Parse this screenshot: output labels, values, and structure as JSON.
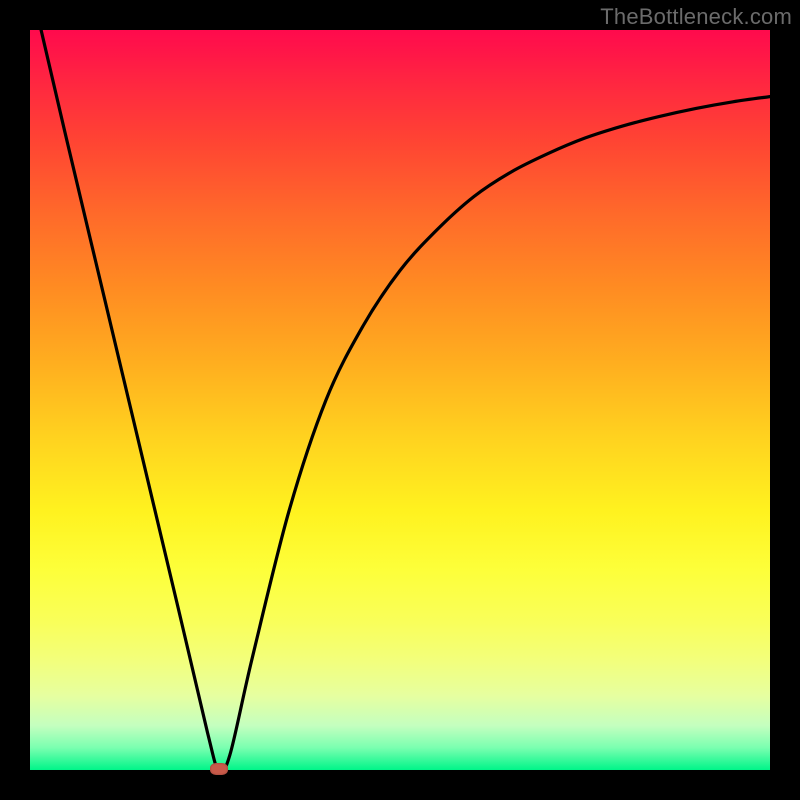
{
  "watermark": "TheBottleneck.com",
  "chart_data": {
    "type": "line",
    "title": "",
    "xlabel": "",
    "ylabel": "",
    "xlim": [
      0,
      100
    ],
    "ylim": [
      0,
      100
    ],
    "grid": false,
    "legend": false,
    "series": [
      {
        "name": "bottleneck-curve",
        "x": [
          1.5,
          5,
          10,
          15,
          20,
          24,
          25.5,
          27,
          30,
          35,
          40,
          45,
          50,
          55,
          60,
          65,
          70,
          75,
          80,
          85,
          90,
          95,
          100
        ],
        "y": [
          100,
          85,
          64,
          43,
          22,
          5,
          0,
          2,
          15,
          35,
          50,
          60,
          67.5,
          73,
          77.5,
          80.8,
          83.3,
          85.4,
          87,
          88.3,
          89.4,
          90.3,
          91
        ]
      }
    ],
    "annotations": [
      {
        "name": "optimal-marker",
        "x": 25.5,
        "y": 0
      }
    ]
  },
  "colors": {
    "curve": "#000000",
    "marker": "#c85a4a",
    "gradient_top": "#ff0a4d",
    "gradient_bottom": "#00f589"
  }
}
